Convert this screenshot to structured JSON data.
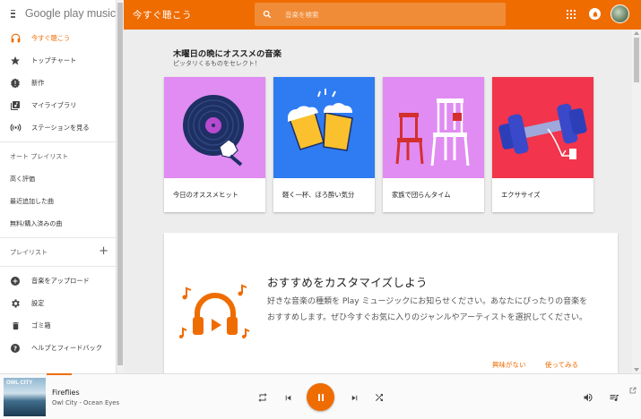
{
  "sidebar": {
    "logo": "Google play music",
    "nav": [
      {
        "label": "今すぐ聴こう",
        "icon": "headphones-icon",
        "active": true
      },
      {
        "label": "トップチャート",
        "icon": "star-icon"
      },
      {
        "label": "新作",
        "icon": "new-release-icon"
      },
      {
        "label": "マイライブラリ",
        "icon": "library-icon"
      },
      {
        "label": "ステーションを見る",
        "icon": "radio-icon"
      }
    ],
    "auto_playlist_header": "オート プレイリスト",
    "auto_playlists": [
      "高く評価",
      "最近追加した曲",
      "無料/購入済みの曲"
    ],
    "playlist_header": "プレイリスト",
    "bottom": [
      {
        "label": "音楽をアップロード",
        "icon": "upload-icon"
      },
      {
        "label": "設定",
        "icon": "gear-icon"
      },
      {
        "label": "ゴミ箱",
        "icon": "trash-icon"
      },
      {
        "label": "ヘルプとフィードバック",
        "icon": "help-icon"
      }
    ]
  },
  "topbar": {
    "title": "今すぐ聴こう",
    "search_placeholder": "音楽を検索"
  },
  "recommendation": {
    "title": "木曜日の晩にオススメの音楽",
    "subtitle": "ピッタリくるものをセレクト！",
    "cards": [
      {
        "label": "今日のオススメヒット",
        "color": "#e08cf2"
      },
      {
        "label": "軽く一杯、ほろ酔い気分",
        "color": "#2f7bf2"
      },
      {
        "label": "家族で団らんタイム",
        "color": "#e08cf2"
      },
      {
        "label": "エクササイズ",
        "color": "#f2344c"
      }
    ]
  },
  "customize": {
    "title": "おすすめをカスタマイズしよう",
    "description": "好きな音楽の種類を Play ミュージックにお知らせください。あなたにぴったりの音楽をおすすめします。ぜひ今すぐお気に入りのジャンルやアーティストを選択してください。",
    "not_interested": "興味がない",
    "use": "使ってみる"
  },
  "player": {
    "album_text": "OWL CITY",
    "track": "Fireflies",
    "artist": "Owl City - Ocean Eyes"
  },
  "colors": {
    "accent": "#ef6c00"
  }
}
